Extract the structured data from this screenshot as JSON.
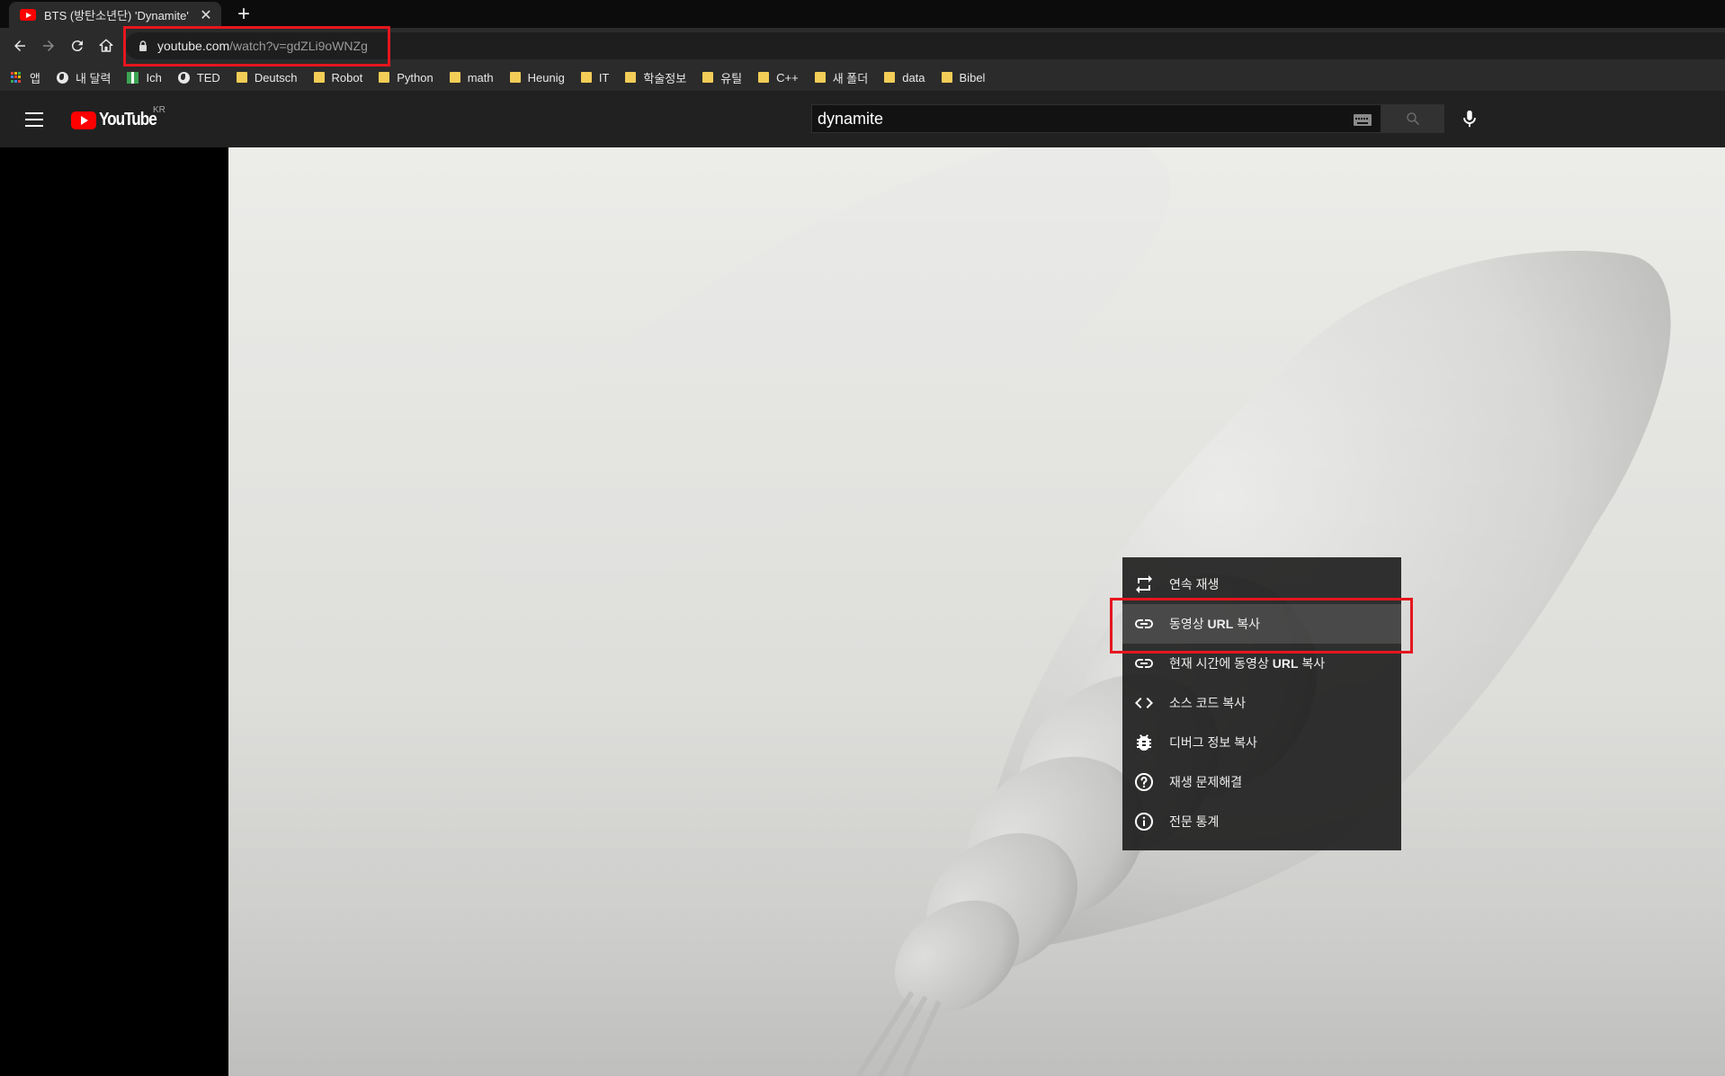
{
  "browser": {
    "tab": {
      "title": "BTS (방탄소년단) 'Dynamite' Official MV"
    },
    "new_tab_label": "+",
    "close_label": "✕",
    "address": {
      "host": "youtube.com",
      "path": "/watch?v=gdZLi9oWNZg"
    },
    "bookmarks": [
      {
        "label": "앱",
        "icon": "apps-grid-icon"
      },
      {
        "label": "내 달력",
        "icon": "globe-icon"
      },
      {
        "label": "Ich",
        "icon": "flag-icon"
      },
      {
        "label": "TED",
        "icon": "globe-icon"
      },
      {
        "label": "Deutsch",
        "icon": "folder-icon"
      },
      {
        "label": "Robot",
        "icon": "folder-icon"
      },
      {
        "label": "Python",
        "icon": "folder-icon"
      },
      {
        "label": "math",
        "icon": "folder-icon"
      },
      {
        "label": "Heunig",
        "icon": "folder-icon"
      },
      {
        "label": "IT",
        "icon": "folder-icon"
      },
      {
        "label": "학술정보",
        "icon": "folder-icon"
      },
      {
        "label": "유틸",
        "icon": "folder-icon"
      },
      {
        "label": "C++",
        "icon": "folder-icon"
      },
      {
        "label": "새 폴더",
        "icon": "folder-icon"
      },
      {
        "label": "data",
        "icon": "folder-icon"
      },
      {
        "label": "Bibel",
        "icon": "folder-icon"
      }
    ]
  },
  "youtube": {
    "logo_text": "YouTube",
    "country_code": "KR",
    "search": {
      "value": "dynamite"
    }
  },
  "context_menu": {
    "items": [
      {
        "label": "연속 재생",
        "icon": "loop-icon"
      },
      {
        "label": "동영상 URL 복사",
        "icon": "link-icon",
        "highlighted": true
      },
      {
        "label": "현재 시간에 동영상 URL 복사",
        "icon": "link-icon"
      },
      {
        "label": "소스 코드 복사",
        "icon": "code-icon"
      },
      {
        "label": "디버그 정보 복사",
        "icon": "bug-icon"
      },
      {
        "label": "재생 문제해결",
        "icon": "help-icon"
      },
      {
        "label": "전문 통계",
        "icon": "info-icon"
      }
    ]
  },
  "colors": {
    "highlight_box": "#e5161e",
    "youtube_red": "#ff0000",
    "folder_yellow": "#f2cd57"
  }
}
